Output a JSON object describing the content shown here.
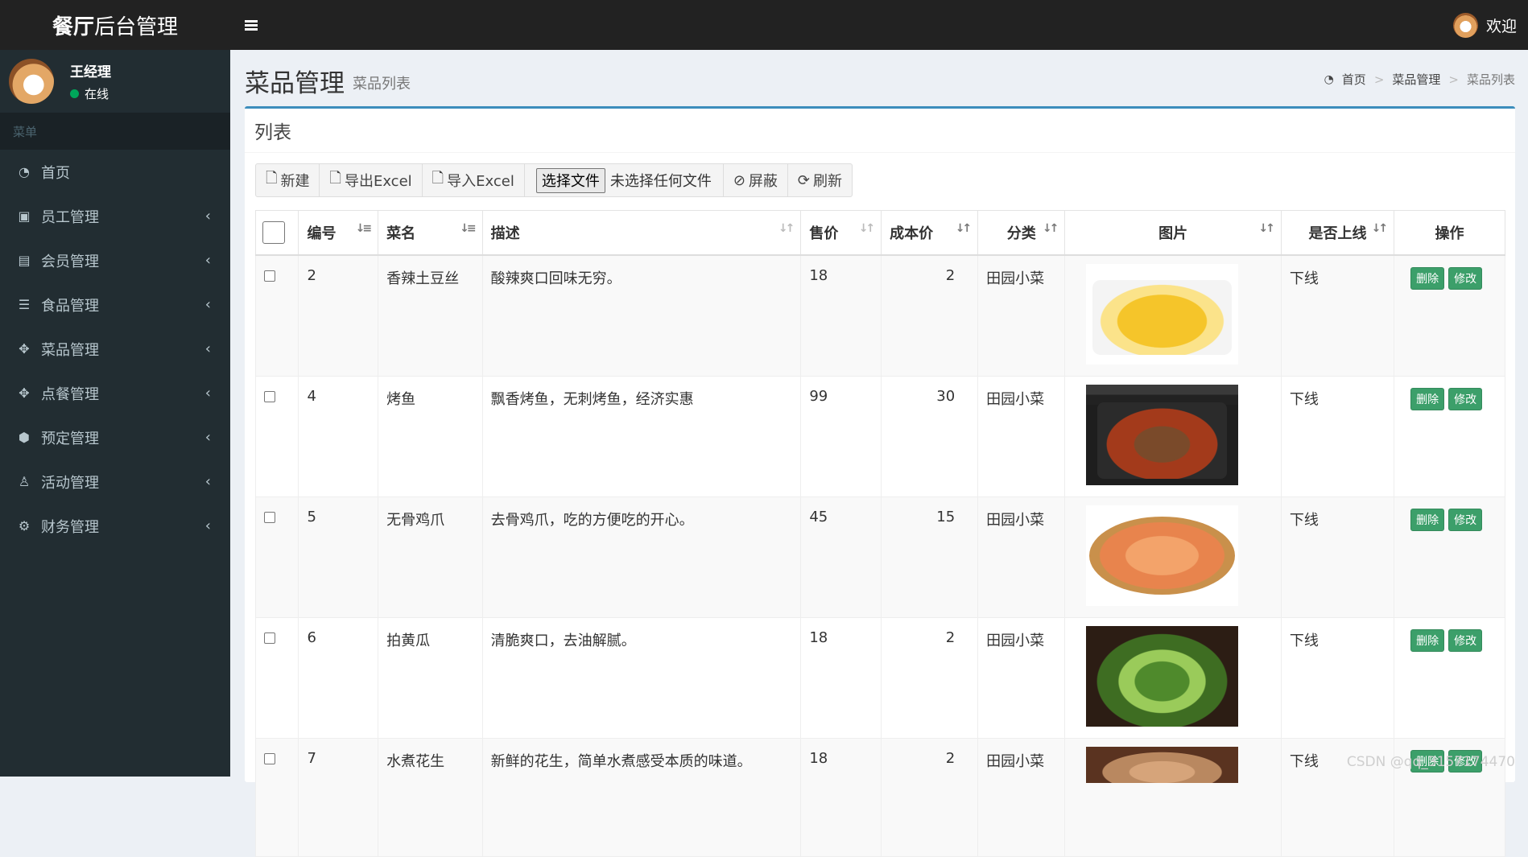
{
  "app": {
    "title_bold": "餐厅",
    "title_rest": "后台管理",
    "welcome": "欢迎"
  },
  "sidebar": {
    "user_name": "王经理",
    "user_status": "在线",
    "menu_header": "菜单",
    "items": [
      {
        "label": "首页",
        "icon": "dashboard-icon",
        "has_children": false
      },
      {
        "label": "员工管理",
        "icon": "id-badge-icon",
        "has_children": true
      },
      {
        "label": "会员管理",
        "icon": "id-card-icon",
        "has_children": true
      },
      {
        "label": "食品管理",
        "icon": "food-tray-icon",
        "has_children": true
      },
      {
        "label": "菜品管理",
        "icon": "arrows-move-icon",
        "has_children": true
      },
      {
        "label": "点餐管理",
        "icon": "arrows-move-icon",
        "has_children": true
      },
      {
        "label": "预定管理",
        "icon": "cube-icon",
        "has_children": true
      },
      {
        "label": "活动管理",
        "icon": "walking-icon",
        "has_children": true
      },
      {
        "label": "财务管理",
        "icon": "gears-icon",
        "has_children": true
      }
    ]
  },
  "page": {
    "title": "菜品管理",
    "subtitle": "菜品列表",
    "breadcrumb": [
      "首页",
      "菜品管理",
      "菜品列表"
    ],
    "box_title": "列表"
  },
  "toolbar": {
    "new_label": "新建",
    "export_label": "导出Excel",
    "import_label": "导入Excel",
    "file_button": "选择文件",
    "file_none": "未选择任何文件",
    "block_label": "屏蔽",
    "refresh_label": "刷新"
  },
  "table": {
    "headers": [
      "编号",
      "菜名",
      "描述",
      "售价",
      "成本价",
      "分类",
      "图片",
      "是否上线",
      "操作"
    ],
    "delete_label": "删除",
    "edit_label": "修改",
    "rows": [
      {
        "id": "2",
        "name": "香辣土豆丝",
        "desc": "酸辣爽口回味无穷。",
        "price": "18",
        "cost": "2",
        "category": "田园小菜",
        "online": "下线",
        "picture": "shredded-potato"
      },
      {
        "id": "4",
        "name": "烤鱼",
        "desc": "飘香烤鱼，无刺烤鱼，经济实惠",
        "price": "99",
        "cost": "30",
        "category": "田园小菜",
        "online": "下线",
        "picture": "grilled-fish"
      },
      {
        "id": "5",
        "name": "无骨鸡爪",
        "desc": "去骨鸡爪，吃的方便吃的开心。",
        "price": "45",
        "cost": "15",
        "category": "田园小菜",
        "online": "下线",
        "picture": "boneless-chicken-feet"
      },
      {
        "id": "6",
        "name": "拍黄瓜",
        "desc": "清脆爽口，去油解腻。",
        "price": "18",
        "cost": "2",
        "category": "田园小菜",
        "online": "下线",
        "picture": "smashed-cucumber"
      },
      {
        "id": "7",
        "name": "水煮花生",
        "desc": "新鲜的花生，简单水煮感受本质的味道。",
        "price": "18",
        "cost": "2",
        "category": "田园小菜",
        "online": "下线",
        "picture": "boiled-peanuts"
      }
    ]
  },
  "watermark": "CSDN @qq_3157174470"
}
